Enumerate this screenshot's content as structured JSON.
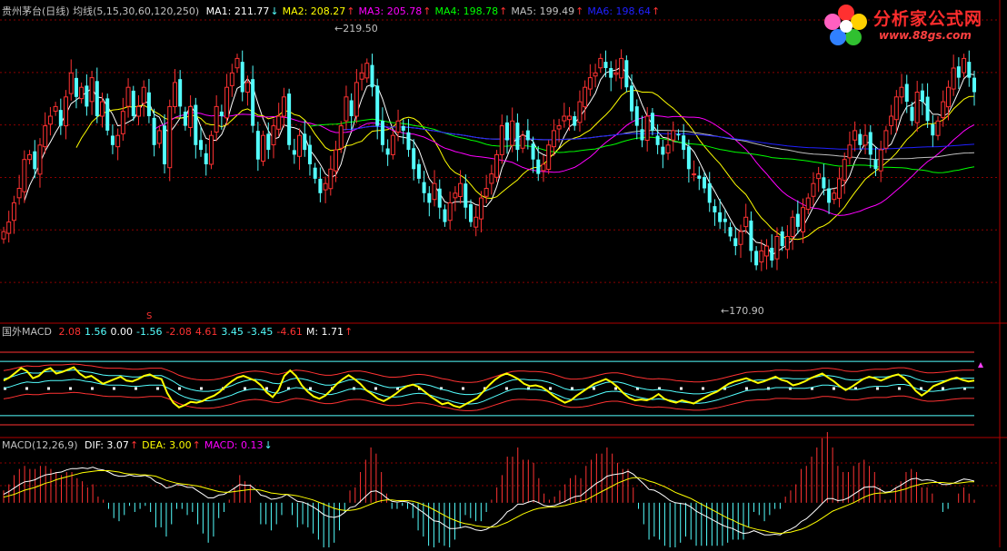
{
  "chart_data": [
    {
      "type": "candlestick",
      "panel": "price",
      "legend": {
        "title": "贵州茅台(日线) 均线(5,15,30,60,120,250)",
        "items": [
          {
            "label": "MA1: 211.77",
            "dir": "down",
            "color": "#ffffff"
          },
          {
            "label": "MA2: 208.27",
            "dir": "up",
            "color": "#ffff00"
          },
          {
            "label": "MA3: 205.78",
            "dir": "up",
            "color": "#ff00ff"
          },
          {
            "label": "MA4: 198.78",
            "dir": "up",
            "color": "#00ff00"
          },
          {
            "label": "MA5: 199.49",
            "dir": "up",
            "color": "#c0c0c0"
          },
          {
            "label": "MA6: 198.64",
            "dir": "up",
            "color": "#2020ff"
          }
        ]
      },
      "ylim": [
        165,
        225
      ],
      "high_label": "219.50",
      "low_label": "170.90",
      "marker_s": "S",
      "colors": {
        "up": "#ff3232",
        "down": "#54ffff"
      },
      "close": [
        181,
        183,
        187,
        190,
        196,
        197,
        194,
        199,
        203,
        205,
        207,
        203,
        209,
        214,
        209,
        211,
        207,
        213,
        205,
        208,
        202,
        199,
        201,
        206,
        211,
        205,
        207,
        211,
        205,
        199,
        202,
        195,
        207,
        212,
        207,
        203,
        207,
        199,
        198,
        195,
        201,
        207,
        205,
        211,
        214,
        217,
        210,
        212,
        203,
        196,
        201,
        198,
        203,
        205,
        209,
        199,
        197,
        201,
        198,
        195,
        192,
        189,
        191,
        194,
        198,
        203,
        209,
        205,
        212,
        214,
        216,
        211,
        203,
        199,
        197,
        201,
        204,
        202,
        198,
        194,
        192,
        189,
        187,
        191,
        186,
        183,
        187,
        189,
        191,
        186,
        183,
        184,
        188,
        190,
        193,
        197,
        203,
        200,
        204,
        198,
        201,
        200,
        196,
        193,
        195,
        199,
        202,
        203,
        205,
        205,
        203,
        208,
        211,
        213,
        214,
        217,
        215,
        213,
        214,
        217,
        211,
        206,
        203,
        200,
        205,
        202,
        199,
        197,
        199,
        202,
        201,
        198,
        194,
        193,
        192,
        190,
        187,
        185,
        183,
        183,
        180,
        178,
        181,
        184,
        177,
        174,
        177,
        178,
        175,
        180,
        178,
        180,
        184,
        182,
        186,
        188,
        191,
        193,
        190,
        187,
        189,
        192,
        196,
        199,
        202,
        199,
        201,
        197,
        194,
        198,
        202,
        205,
        209,
        211,
        208,
        204,
        210,
        208,
        204,
        201,
        204,
        208,
        211,
        215,
        213,
        217,
        213,
        210
      ]
    },
    {
      "type": "line",
      "panel": "indicator1",
      "legend": {
        "title": "国外MACD",
        "items": [
          {
            "label": "2.08",
            "color": "#ff3232"
          },
          {
            "label": "1.56",
            "color": "#54ffff"
          },
          {
            "label": "0.00",
            "color": "#ffffff"
          },
          {
            "label": "-1.56",
            "color": "#54ffff"
          },
          {
            "label": "-2.08",
            "color": "#ff3232"
          },
          {
            "label": "4.61",
            "color": "#ff3232"
          },
          {
            "label": "3.45",
            "color": "#54ffff"
          },
          {
            "label": "-3.45",
            "color": "#54ffff"
          },
          {
            "label": "-4.61",
            "color": "#ff3232"
          },
          {
            "label": "M: 1.71",
            "dir": "up",
            "color": "#ffffff"
          }
        ]
      },
      "ylim": [
        -6,
        6
      ],
      "bands": {
        "outer": 4.61,
        "inner": 3.45
      },
      "main": [
        1,
        1.4,
        2,
        2.6,
        2.2,
        1.3,
        1.6,
        2.3,
        2.6,
        1.9,
        2.1,
        2.4,
        2.7,
        1.9,
        1.4,
        1.6,
        1.1,
        0.6,
        0.9,
        1.2,
        1.5,
        1.0,
        0.9,
        1.2,
        1.6,
        1.8,
        1.4,
        1.2,
        -0.6,
        -1.8,
        -2.4,
        -2.1,
        -1.7,
        -1.8,
        -1.6,
        -1.2,
        -0.9,
        -0.4,
        0.3,
        0.9,
        1.4,
        1.6,
        1.3,
        1.0,
        0.4,
        -0.5,
        -1.1,
        -0.2,
        1.6,
        2.3,
        1.6,
        0.4,
        -0.4,
        -1.0,
        -1.3,
        -0.9,
        -0.2,
        0.6,
        1.2,
        1.7,
        1.2,
        0.6,
        -0.2,
        -0.7,
        -1.3,
        -1.6,
        -1.2,
        -0.7,
        -0.1,
        0.3,
        0.5,
        0.2,
        -0.4,
        -1.0,
        -1.5,
        -2.0,
        -1.8,
        -2.2,
        -2.4,
        -2.0,
        -1.6,
        -1.2,
        -0.4,
        0.4,
        1.1,
        1.6,
        1.9,
        1.6,
        1.2,
        0.6,
        0.3,
        0.4,
        0.2,
        -0.3,
        -0.9,
        -1.4,
        -1.8,
        -1.5,
        -0.9,
        -0.4,
        0.1,
        0.6,
        0.9,
        1.2,
        0.8,
        0.2,
        -0.6,
        -1.2,
        -1.5,
        -1.4,
        -1.5,
        -1.2,
        -0.7,
        -1.3,
        -1.6,
        -1.8,
        -1.5,
        -1.7,
        -1.9,
        -1.5,
        -1.1,
        -0.7,
        -0.4,
        0.1,
        0.6,
        0.9,
        1.1,
        1.3,
        1.0,
        0.7,
        0.9,
        1.2,
        1.5,
        1.1,
        0.9,
        0.4,
        0.6,
        0.9,
        1.3,
        1.6,
        1.9,
        1.4,
        0.9,
        0.3,
        -0.2,
        0.2,
        0.7,
        1.2,
        1.5,
        1.3,
        1.0,
        1.3,
        1.6,
        1.8,
        1.3,
        0.6,
        -0.3,
        -0.9,
        -0.4,
        0.3,
        0.6,
        0.9,
        1.2,
        1.4,
        1.1,
        0.9,
        1.0
      ],
      "signal": [
        0.8,
        1.0,
        1.3,
        1.6,
        1.8,
        1.7,
        1.7,
        1.9,
        2.0,
        2.0,
        2.0,
        2.1,
        2.2,
        2.1,
        1.9,
        1.8,
        1.6,
        1.4,
        1.3,
        1.3,
        1.3,
        1.2,
        1.1,
        1.1,
        1.2,
        1.3,
        1.3,
        1.3,
        0.9,
        0.4,
        -0.2,
        -0.6,
        -0.9,
        -1.1,
        -1.2,
        -1.2,
        -1.1,
        -0.9,
        -0.6,
        -0.3,
        0.1,
        0.4,
        0.6,
        0.7,
        0.6,
        0.4,
        0.1,
        0.0,
        0.3,
        0.7,
        0.9,
        0.8,
        0.6,
        0.3,
        0.0,
        -0.2,
        -0.2,
        0.0,
        0.3,
        0.6,
        0.7,
        0.7,
        0.5,
        0.2,
        -0.1,
        -0.4,
        -0.6,
        -0.6,
        -0.5,
        -0.3,
        -0.1,
        0.0,
        -0.1,
        -0.3,
        -0.6,
        -0.9,
        -1.1,
        -1.4,
        -1.6,
        -1.7,
        -1.7,
        -1.6,
        -1.3,
        -0.9,
        -0.5,
        -0.1,
        0.3,
        0.6,
        0.7,
        0.7,
        0.6,
        0.6,
        0.5,
        0.3,
        0.0,
        -0.4,
        -0.8,
        -1.0,
        -1.0,
        -0.9,
        -0.7,
        -0.4,
        -0.1,
        0.2,
        0.3,
        0.3,
        0.1,
        -0.2,
        -0.5,
        -0.7,
        -0.9,
        -1.0,
        -0.9,
        -1.0,
        -1.1,
        -1.3,
        -1.4,
        -1.5,
        -1.6,
        -1.6,
        -1.5,
        -1.3,
        -1.1,
        -0.8,
        -0.5,
        -0.2,
        0.1,
        0.4,
        0.5,
        0.6,
        0.6,
        0.7,
        0.9,
        0.9,
        0.9,
        0.8,
        0.8,
        0.8,
        0.9,
        1.1,
        1.3,
        1.3,
        1.2,
        1.0,
        0.7,
        0.6,
        0.6,
        0.8,
        1.0,
        1.1,
        1.1,
        1.1,
        1.3,
        1.4,
        1.4,
        1.2,
        0.8,
        0.5,
        0.3,
        0.3,
        0.4,
        0.5,
        0.7,
        0.8,
        0.9,
        0.9,
        0.9
      ]
    },
    {
      "type": "bar+line",
      "panel": "indicator2",
      "legend": {
        "title": "MACD(12,26,9)",
        "items": [
          {
            "label": "DIF: 3.07",
            "dir": "up",
            "color": "#ffffff"
          },
          {
            "label": "DEA: 3.00",
            "dir": "up",
            "color": "#ffff00"
          },
          {
            "label": "MACD: 0.13",
            "dir": "down",
            "color": "#ff00ff"
          }
        ]
      },
      "ylim": [
        -6,
        7
      ],
      "dif": [
        1.2,
        1.6,
        2.1,
        2.6,
        3.0,
        3.1,
        3.3,
        3.7,
        4.0,
        4.1,
        4.3,
        4.4,
        4.7,
        4.9,
        4.9,
        5.0,
        4.9,
        5.1,
        4.8,
        4.7,
        4.4,
        4.0,
        3.8,
        3.8,
        4.0,
        3.8,
        3.8,
        3.9,
        3.6,
        3.0,
        2.7,
        2.1,
        2.3,
        2.6,
        2.5,
        2.2,
        2.2,
        1.7,
        1.2,
        0.7,
        0.7,
        1.1,
        1.2,
        1.6,
        2.1,
        2.6,
        2.5,
        2.5,
        1.9,
        1.1,
        0.9,
        0.5,
        0.6,
        0.8,
        1.2,
        0.7,
        0.2,
        0.1,
        -0.2,
        -0.6,
        -1.1,
        -1.7,
        -2.0,
        -2.1,
        -1.9,
        -1.4,
        -0.7,
        -0.5,
        0.2,
        0.9,
        1.6,
        1.7,
        1.3,
        0.7,
        0.2,
        0.1,
        0.2,
        0.1,
        -0.3,
        -0.9,
        -1.4,
        -2.0,
        -2.6,
        -2.7,
        -3.2,
        -3.7,
        -3.7,
        -3.6,
        -3.4,
        -3.6,
        -3.9,
        -4.0,
        -3.8,
        -3.4,
        -2.9,
        -2.2,
        -1.3,
        -0.9,
        -0.2,
        -0.2,
        0.1,
        0.3,
        0.0,
        -0.4,
        -0.5,
        -0.4,
        -0.1,
        0.2,
        0.6,
        0.9,
        1.0,
        1.6,
        2.2,
        2.8,
        3.2,
        3.8,
        4.0,
        4.1,
        4.2,
        4.5,
        4.1,
        3.4,
        2.7,
        1.9,
        1.8,
        1.4,
        0.9,
        0.3,
        0.0,
        -0.1,
        -0.2,
        -0.6,
        -1.2,
        -1.6,
        -2.0,
        -2.4,
        -2.8,
        -3.2,
        -3.5,
        -3.7,
        -4.1,
        -4.4,
        -4.3,
        -4.0,
        -4.3,
        -4.6,
        -4.6,
        -4.5,
        -4.6,
        -4.1,
        -3.8,
        -3.4,
        -2.7,
        -2.3,
        -1.6,
        -0.9,
        -0.1,
        0.6,
        0.6,
        0.3,
        0.4,
        0.7,
        1.2,
        1.7,
        2.2,
        2.3,
        2.3,
        1.9,
        1.5,
        1.6,
        2.1,
        2.5,
        3.0,
        3.4,
        3.5,
        3.2,
        3.3,
        3.2,
        2.9,
        2.6,
        2.6,
        2.8,
        3.1,
        3.4,
        3.3,
        3.1
      ],
      "dea": [
        0.8,
        1.0,
        1.2,
        1.5,
        1.8,
        2.0,
        2.2,
        2.5,
        2.8,
        3.0,
        3.3,
        3.5,
        3.7,
        3.9,
        4.1,
        4.3,
        4.4,
        4.5,
        4.6,
        4.6,
        4.6,
        4.5,
        4.4,
        4.2,
        4.1,
        4.1,
        4.0,
        4.0,
        3.9,
        3.8,
        3.5,
        3.2,
        3.0,
        2.8,
        2.7,
        2.6,
        2.5,
        2.4,
        2.2,
        2.0,
        1.8,
        1.6,
        1.5,
        1.5,
        1.6,
        1.7,
        1.8,
        1.9,
        1.9,
        1.8,
        1.6,
        1.4,
        1.3,
        1.2,
        1.2,
        1.1,
        1.0,
        0.8,
        0.6,
        0.4,
        0.1,
        -0.2,
        -0.5,
        -0.8,
        -1.0,
        -1.1,
        -1.1,
        -1.0,
        -0.8,
        -0.5,
        -0.2,
        0.1,
        0.3,
        0.4,
        0.4,
        0.3,
        0.3,
        0.3,
        0.2,
        0.0,
        -0.3,
        -0.6,
        -1.0,
        -1.4,
        -1.8,
        -2.2,
        -2.5,
        -2.8,
        -3.0,
        -3.1,
        -3.3,
        -3.4,
        -3.5,
        -3.5,
        -3.4,
        -3.1,
        -2.8,
        -2.4,
        -2.0,
        -1.6,
        -1.3,
        -1.0,
        -0.8,
        -0.7,
        -0.6,
        -0.6,
        -0.5,
        -0.4,
        -0.2,
        0.0,
        0.2,
        0.4,
        0.8,
        1.2,
        1.6,
        2.0,
        2.4,
        2.8,
        3.1,
        3.4,
        3.6,
        3.6,
        3.4,
        3.1,
        2.9,
        2.6,
        2.3,
        1.9,
        1.5,
        1.2,
        0.9,
        0.6,
        0.2,
        -0.2,
        -0.6,
        -1.0,
        -1.4,
        -1.8,
        -2.2,
        -2.5,
        -2.9,
        -3.2,
        -3.5,
        -3.7,
        -3.9,
        -4.0,
        -4.2,
        -4.3,
        -4.4,
        -4.3,
        -4.2,
        -4.0,
        -3.8,
        -3.5,
        -3.1,
        -2.7,
        -2.2,
        -1.7,
        -1.2,
        -0.9,
        -0.6,
        -0.3,
        0.0,
        0.4,
        0.8,
        1.1,
        1.3,
        1.4,
        1.4,
        1.5,
        1.6,
        1.8,
        2.0,
        2.3,
        2.5,
        2.7,
        2.8,
        2.9,
        2.9,
        2.9,
        2.8,
        2.8,
        2.8,
        2.9,
        3.0,
        3.0
      ]
    }
  ]
}
